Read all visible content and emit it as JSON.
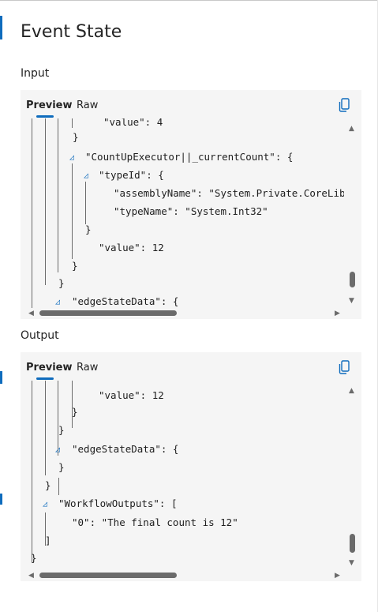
{
  "panel_title": "Event State",
  "sections": {
    "input": {
      "label": "Input",
      "tabs": [
        "Preview",
        "Raw"
      ],
      "active_tab": "Preview",
      "lines": [
        "\"value\": 4",
        "}",
        "\"CountUpExecutor||_currentCount\": {",
        "\"typeId\": {",
        "\"assemblyName\": \"System.Private.CoreLib, V",
        "\"typeName\": \"System.Int32\"",
        "}",
        "\"value\": 12",
        "}",
        "}",
        "\"edgeStateData\": {"
      ]
    },
    "output": {
      "label": "Output",
      "tabs": [
        "Preview",
        "Raw"
      ],
      "active_tab": "Preview",
      "lines": [
        "\"value\": 12",
        "}",
        "}",
        "\"edgeStateData\": {",
        "}",
        "}",
        "\"WorkflowOutputs\": [",
        "\"0\": \"The final count is 12\"",
        "]",
        "}"
      ]
    }
  },
  "icons": {
    "copy": "copy-icon",
    "fold": "fold-expanded-icon",
    "scroll_up": "scroll-up-icon",
    "scroll_down": "scroll-down-icon",
    "scroll_left": "scroll-left-icon",
    "scroll_right": "scroll-right-icon"
  },
  "colors": {
    "accent": "#0f6cbd",
    "panel_bg": "#f5f5f5",
    "text": "#242424"
  }
}
